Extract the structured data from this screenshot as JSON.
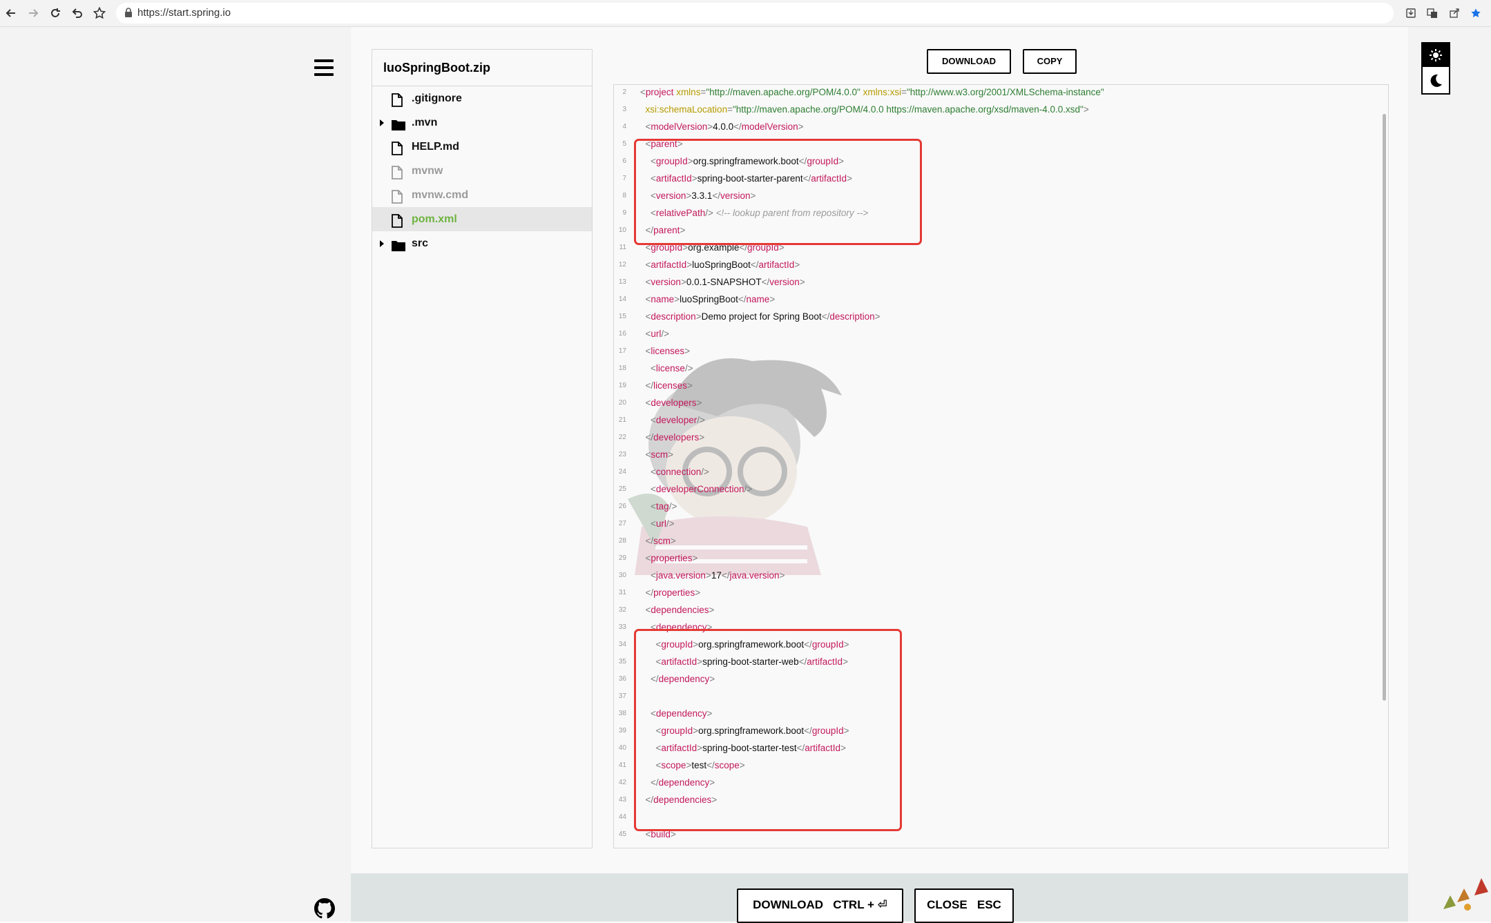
{
  "browser": {
    "url": "https://start.spring.io"
  },
  "tree": {
    "title": "luoSpringBoot.zip",
    "items": [
      {
        "label": ".gitignore",
        "type": "file",
        "state": "normal"
      },
      {
        "label": ".mvn",
        "type": "folder",
        "state": "normal"
      },
      {
        "label": "HELP.md",
        "type": "file",
        "state": "normal"
      },
      {
        "label": "mvnw",
        "type": "file",
        "state": "disabled"
      },
      {
        "label": "mvnw.cmd",
        "type": "file",
        "state": "disabled"
      },
      {
        "label": "pom.xml",
        "type": "file",
        "state": "selected"
      },
      {
        "label": "src",
        "type": "folder",
        "state": "normal"
      }
    ]
  },
  "toolbar": {
    "download_label": "DOWNLOAD",
    "copy_label": "COPY"
  },
  "code": {
    "lines": [
      {
        "n": "2",
        "c": [
          [
            "br",
            "<"
          ],
          [
            "tag",
            "project"
          ],
          [
            "tx",
            " "
          ],
          [
            "attr",
            "xmlns"
          ],
          [
            "br",
            "="
          ],
          [
            "str",
            "\"http://maven.apache.org/POM/4.0.0\""
          ],
          [
            "tx",
            " "
          ],
          [
            "attr",
            "xmlns:xsi"
          ],
          [
            "br",
            "="
          ],
          [
            "str",
            "\"http://www.w3.org/2001/XMLSchema-instance\""
          ]
        ]
      },
      {
        "n": "3",
        "c": [
          [
            "tx",
            "  "
          ],
          [
            "attr",
            "xsi:schemaLocation"
          ],
          [
            "br",
            "="
          ],
          [
            "str",
            "\"http://maven.apache.org/POM/4.0.0 https://maven.apache.org/xsd/maven-4.0.0.xsd\""
          ],
          [
            "br",
            ">"
          ]
        ]
      },
      {
        "n": "4",
        "c": [
          [
            "tx",
            "  "
          ],
          [
            "br",
            "<"
          ],
          [
            "tag",
            "modelVersion"
          ],
          [
            "br",
            ">"
          ],
          [
            "tx",
            "4.0.0"
          ],
          [
            "br",
            "</"
          ],
          [
            "tag",
            "modelVersion"
          ],
          [
            "br",
            ">"
          ]
        ]
      },
      {
        "n": "5",
        "c": [
          [
            "tx",
            "  "
          ],
          [
            "br",
            "<"
          ],
          [
            "tag",
            "parent"
          ],
          [
            "br",
            ">"
          ]
        ]
      },
      {
        "n": "6",
        "c": [
          [
            "tx",
            "    "
          ],
          [
            "br",
            "<"
          ],
          [
            "tag",
            "groupId"
          ],
          [
            "br",
            ">"
          ],
          [
            "tx",
            "org.springframework.boot"
          ],
          [
            "br",
            "</"
          ],
          [
            "tag",
            "groupId"
          ],
          [
            "br",
            ">"
          ]
        ]
      },
      {
        "n": "7",
        "c": [
          [
            "tx",
            "    "
          ],
          [
            "br",
            "<"
          ],
          [
            "tag",
            "artifactId"
          ],
          [
            "br",
            ">"
          ],
          [
            "tx",
            "spring-boot-starter-parent"
          ],
          [
            "br",
            "</"
          ],
          [
            "tag",
            "artifactId"
          ],
          [
            "br",
            ">"
          ]
        ]
      },
      {
        "n": "8",
        "c": [
          [
            "tx",
            "    "
          ],
          [
            "br",
            "<"
          ],
          [
            "tag",
            "version"
          ],
          [
            "br",
            ">"
          ],
          [
            "tx",
            "3.3.1"
          ],
          [
            "br",
            "</"
          ],
          [
            "tag",
            "version"
          ],
          [
            "br",
            ">"
          ]
        ]
      },
      {
        "n": "9",
        "c": [
          [
            "tx",
            "    "
          ],
          [
            "br",
            "<"
          ],
          [
            "tag",
            "relativePath"
          ],
          [
            "br",
            "/>"
          ],
          [
            "tx",
            " "
          ],
          [
            "cm",
            "<!-- lookup parent from repository -->"
          ]
        ]
      },
      {
        "n": "10",
        "c": [
          [
            "tx",
            "  "
          ],
          [
            "br",
            "</"
          ],
          [
            "tag",
            "parent"
          ],
          [
            "br",
            ">"
          ]
        ]
      },
      {
        "n": "11",
        "c": [
          [
            "tx",
            "  "
          ],
          [
            "br",
            "<"
          ],
          [
            "tag",
            "groupId"
          ],
          [
            "br",
            ">"
          ],
          [
            "tx",
            "org.example"
          ],
          [
            "br",
            "</"
          ],
          [
            "tag",
            "groupId"
          ],
          [
            "br",
            ">"
          ]
        ]
      },
      {
        "n": "12",
        "c": [
          [
            "tx",
            "  "
          ],
          [
            "br",
            "<"
          ],
          [
            "tag",
            "artifactId"
          ],
          [
            "br",
            ">"
          ],
          [
            "tx",
            "luoSpringBoot"
          ],
          [
            "br",
            "</"
          ],
          [
            "tag",
            "artifactId"
          ],
          [
            "br",
            ">"
          ]
        ]
      },
      {
        "n": "13",
        "c": [
          [
            "tx",
            "  "
          ],
          [
            "br",
            "<"
          ],
          [
            "tag",
            "version"
          ],
          [
            "br",
            ">"
          ],
          [
            "tx",
            "0.0.1-SNAPSHOT"
          ],
          [
            "br",
            "</"
          ],
          [
            "tag",
            "version"
          ],
          [
            "br",
            ">"
          ]
        ]
      },
      {
        "n": "14",
        "c": [
          [
            "tx",
            "  "
          ],
          [
            "br",
            "<"
          ],
          [
            "tag",
            "name"
          ],
          [
            "br",
            ">"
          ],
          [
            "tx",
            "luoSpringBoot"
          ],
          [
            "br",
            "</"
          ],
          [
            "tag",
            "name"
          ],
          [
            "br",
            ">"
          ]
        ]
      },
      {
        "n": "15",
        "c": [
          [
            "tx",
            "  "
          ],
          [
            "br",
            "<"
          ],
          [
            "tag",
            "description"
          ],
          [
            "br",
            ">"
          ],
          [
            "tx",
            "Demo project for Spring Boot"
          ],
          [
            "br",
            "</"
          ],
          [
            "tag",
            "description"
          ],
          [
            "br",
            ">"
          ]
        ]
      },
      {
        "n": "16",
        "c": [
          [
            "tx",
            "  "
          ],
          [
            "br",
            "<"
          ],
          [
            "tag",
            "url"
          ],
          [
            "br",
            "/>"
          ]
        ]
      },
      {
        "n": "17",
        "c": [
          [
            "tx",
            "  "
          ],
          [
            "br",
            "<"
          ],
          [
            "tag",
            "licenses"
          ],
          [
            "br",
            ">"
          ]
        ]
      },
      {
        "n": "18",
        "c": [
          [
            "tx",
            "    "
          ],
          [
            "br",
            "<"
          ],
          [
            "tag",
            "license"
          ],
          [
            "br",
            "/>"
          ]
        ]
      },
      {
        "n": "19",
        "c": [
          [
            "tx",
            "  "
          ],
          [
            "br",
            "</"
          ],
          [
            "tag",
            "licenses"
          ],
          [
            "br",
            ">"
          ]
        ]
      },
      {
        "n": "20",
        "c": [
          [
            "tx",
            "  "
          ],
          [
            "br",
            "<"
          ],
          [
            "tag",
            "developers"
          ],
          [
            "br",
            ">"
          ]
        ]
      },
      {
        "n": "21",
        "c": [
          [
            "tx",
            "    "
          ],
          [
            "br",
            "<"
          ],
          [
            "tag",
            "developer"
          ],
          [
            "br",
            "/>"
          ]
        ]
      },
      {
        "n": "22",
        "c": [
          [
            "tx",
            "  "
          ],
          [
            "br",
            "</"
          ],
          [
            "tag",
            "developers"
          ],
          [
            "br",
            ">"
          ]
        ]
      },
      {
        "n": "23",
        "c": [
          [
            "tx",
            "  "
          ],
          [
            "br",
            "<"
          ],
          [
            "tag",
            "scm"
          ],
          [
            "br",
            ">"
          ]
        ]
      },
      {
        "n": "24",
        "c": [
          [
            "tx",
            "    "
          ],
          [
            "br",
            "<"
          ],
          [
            "tag",
            "connection"
          ],
          [
            "br",
            "/>"
          ]
        ]
      },
      {
        "n": "25",
        "c": [
          [
            "tx",
            "    "
          ],
          [
            "br",
            "<"
          ],
          [
            "tag",
            "developerConnection"
          ],
          [
            "br",
            "/>"
          ]
        ]
      },
      {
        "n": "26",
        "c": [
          [
            "tx",
            "    "
          ],
          [
            "br",
            "<"
          ],
          [
            "tag",
            "tag"
          ],
          [
            "br",
            "/>"
          ]
        ]
      },
      {
        "n": "27",
        "c": [
          [
            "tx",
            "    "
          ],
          [
            "br",
            "<"
          ],
          [
            "tag",
            "url"
          ],
          [
            "br",
            "/>"
          ]
        ]
      },
      {
        "n": "28",
        "c": [
          [
            "tx",
            "  "
          ],
          [
            "br",
            "</"
          ],
          [
            "tag",
            "scm"
          ],
          [
            "br",
            ">"
          ]
        ]
      },
      {
        "n": "29",
        "c": [
          [
            "tx",
            "  "
          ],
          [
            "br",
            "<"
          ],
          [
            "tag",
            "properties"
          ],
          [
            "br",
            ">"
          ]
        ]
      },
      {
        "n": "30",
        "c": [
          [
            "tx",
            "    "
          ],
          [
            "br",
            "<"
          ],
          [
            "tag",
            "java.version"
          ],
          [
            "br",
            ">"
          ],
          [
            "tx",
            "17"
          ],
          [
            "br",
            "</"
          ],
          [
            "tag",
            "java.version"
          ],
          [
            "br",
            ">"
          ]
        ]
      },
      {
        "n": "31",
        "c": [
          [
            "tx",
            "  "
          ],
          [
            "br",
            "</"
          ],
          [
            "tag",
            "properties"
          ],
          [
            "br",
            ">"
          ]
        ]
      },
      {
        "n": "32",
        "c": [
          [
            "tx",
            "  "
          ],
          [
            "br",
            "<"
          ],
          [
            "tag",
            "dependencies"
          ],
          [
            "br",
            ">"
          ]
        ]
      },
      {
        "n": "33",
        "c": [
          [
            "tx",
            "    "
          ],
          [
            "br",
            "<"
          ],
          [
            "tag",
            "dependency"
          ],
          [
            "br",
            ">"
          ]
        ]
      },
      {
        "n": "34",
        "c": [
          [
            "tx",
            "      "
          ],
          [
            "br",
            "<"
          ],
          [
            "tag",
            "groupId"
          ],
          [
            "br",
            ">"
          ],
          [
            "tx",
            "org.springframework.boot"
          ],
          [
            "br",
            "</"
          ],
          [
            "tag",
            "groupId"
          ],
          [
            "br",
            ">"
          ]
        ]
      },
      {
        "n": "35",
        "c": [
          [
            "tx",
            "      "
          ],
          [
            "br",
            "<"
          ],
          [
            "tag",
            "artifactId"
          ],
          [
            "br",
            ">"
          ],
          [
            "tx",
            "spring-boot-starter-web"
          ],
          [
            "br",
            "</"
          ],
          [
            "tag",
            "artifactId"
          ],
          [
            "br",
            ">"
          ]
        ]
      },
      {
        "n": "36",
        "c": [
          [
            "tx",
            "    "
          ],
          [
            "br",
            "</"
          ],
          [
            "tag",
            "dependency"
          ],
          [
            "br",
            ">"
          ]
        ]
      },
      {
        "n": "37",
        "c": []
      },
      {
        "n": "38",
        "c": [
          [
            "tx",
            "    "
          ],
          [
            "br",
            "<"
          ],
          [
            "tag",
            "dependency"
          ],
          [
            "br",
            ">"
          ]
        ]
      },
      {
        "n": "39",
        "c": [
          [
            "tx",
            "      "
          ],
          [
            "br",
            "<"
          ],
          [
            "tag",
            "groupId"
          ],
          [
            "br",
            ">"
          ],
          [
            "tx",
            "org.springframework.boot"
          ],
          [
            "br",
            "</"
          ],
          [
            "tag",
            "groupId"
          ],
          [
            "br",
            ">"
          ]
        ]
      },
      {
        "n": "40",
        "c": [
          [
            "tx",
            "      "
          ],
          [
            "br",
            "<"
          ],
          [
            "tag",
            "artifactId"
          ],
          [
            "br",
            ">"
          ],
          [
            "tx",
            "spring-boot-starter-test"
          ],
          [
            "br",
            "</"
          ],
          [
            "tag",
            "artifactId"
          ],
          [
            "br",
            ">"
          ]
        ]
      },
      {
        "n": "41",
        "c": [
          [
            "tx",
            "      "
          ],
          [
            "br",
            "<"
          ],
          [
            "tag",
            "scope"
          ],
          [
            "br",
            ">"
          ],
          [
            "tx",
            "test"
          ],
          [
            "br",
            "</"
          ],
          [
            "tag",
            "scope"
          ],
          [
            "br",
            ">"
          ]
        ]
      },
      {
        "n": "42",
        "c": [
          [
            "tx",
            "    "
          ],
          [
            "br",
            "</"
          ],
          [
            "tag",
            "dependency"
          ],
          [
            "br",
            ">"
          ]
        ]
      },
      {
        "n": "43",
        "c": [
          [
            "tx",
            "  "
          ],
          [
            "br",
            "</"
          ],
          [
            "tag",
            "dependencies"
          ],
          [
            "br",
            ">"
          ]
        ]
      },
      {
        "n": "44",
        "c": []
      },
      {
        "n": "45",
        "c": [
          [
            "tx",
            "  "
          ],
          [
            "br",
            "<"
          ],
          [
            "tag",
            "build"
          ],
          [
            "br",
            ">"
          ]
        ]
      }
    ]
  },
  "footer": {
    "download_label": "DOWNLOAD",
    "download_shortcut": "CTRL + ⏎",
    "close_label": "CLOSE",
    "close_shortcut": "ESC"
  },
  "colors": {
    "accent": "#6db33f",
    "highlight": "#e53935",
    "tag": "#c2185b",
    "attr": "#b59a00",
    "string": "#2e7d32"
  },
  "icons": [
    "back-icon",
    "forward-icon",
    "reload-icon",
    "history-icon",
    "star-icon",
    "lock-icon",
    "menu-icon",
    "github-icon",
    "file-icon",
    "folder-icon",
    "sun-icon",
    "moon-icon"
  ]
}
